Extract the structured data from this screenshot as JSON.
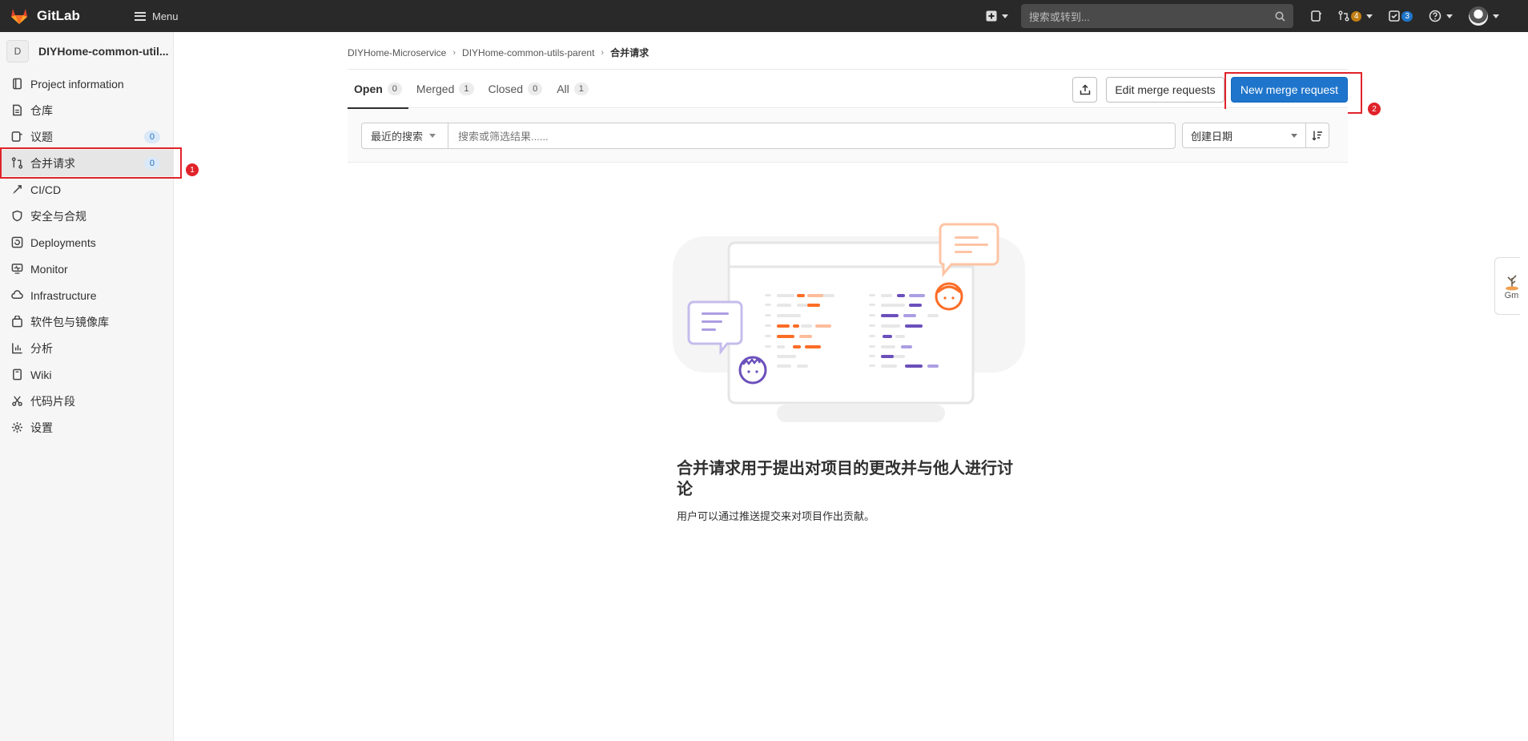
{
  "topbar": {
    "brand": "GitLab",
    "menu_label": "Menu",
    "search_placeholder": "搜索或转到...",
    "mr_count": "4",
    "todo_count": "3"
  },
  "sidebar": {
    "project_initial": "D",
    "project_name": "DIYHome-common-util...",
    "items": [
      {
        "label": "Project information",
        "icon": "info-icon"
      },
      {
        "label": "仓库",
        "icon": "doc-icon"
      },
      {
        "label": "议题",
        "icon": "issues-icon",
        "count": "0"
      },
      {
        "label": "合并请求",
        "icon": "merge-request-icon",
        "count": "0"
      },
      {
        "label": "CI/CD",
        "icon": "rocket-icon"
      },
      {
        "label": "安全与合规",
        "icon": "shield-icon"
      },
      {
        "label": "Deployments",
        "icon": "deploy-icon"
      },
      {
        "label": "Monitor",
        "icon": "monitor-icon"
      },
      {
        "label": "Infrastructure",
        "icon": "cloud-icon"
      },
      {
        "label": "软件包与镜像库",
        "icon": "package-icon"
      },
      {
        "label": "分析",
        "icon": "chart-icon"
      },
      {
        "label": "Wiki",
        "icon": "book-icon"
      },
      {
        "label": "代码片段",
        "icon": "scissors-icon"
      },
      {
        "label": "设置",
        "icon": "gear-icon"
      }
    ]
  },
  "annotations": {
    "first": "1",
    "second": "2"
  },
  "breadcrumb": {
    "group": "DIYHome-Microservice",
    "project": "DIYHome-common-utils-parent",
    "current": "合并请求"
  },
  "tabs": [
    {
      "label": "Open",
      "count": "0"
    },
    {
      "label": "Merged",
      "count": "1"
    },
    {
      "label": "Closed",
      "count": "0"
    },
    {
      "label": "All",
      "count": "1"
    }
  ],
  "actions": {
    "edit": "Edit merge requests",
    "new": "New merge request"
  },
  "filter": {
    "recent": "最近的搜索",
    "placeholder": "搜索或筛选结果......",
    "sort": "创建日期"
  },
  "empty": {
    "title": "合并请求用于提出对项目的更改并与他人进行讨论",
    "subtitle": "用户可以通过推送提交来对项目作出贡献。"
  },
  "widget": {
    "label": "Gm"
  }
}
